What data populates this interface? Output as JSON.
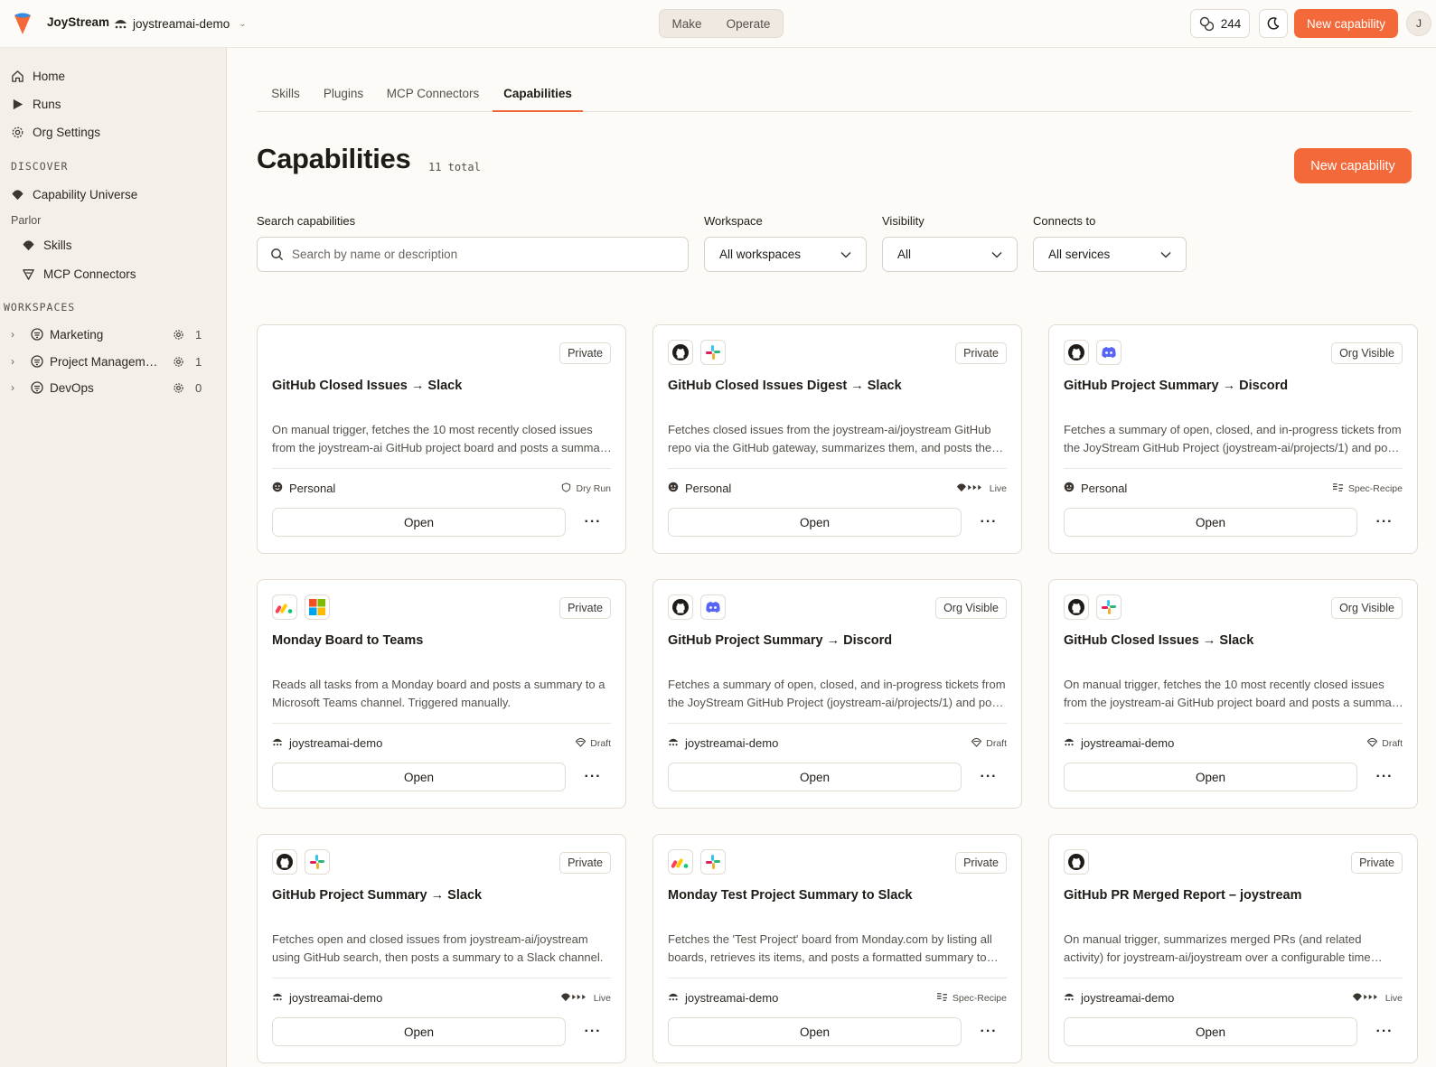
{
  "app": {
    "name": "JoyStream",
    "org": "joystreamai-demo"
  },
  "mode": {
    "make": "Make",
    "operate": "Operate"
  },
  "credits": "244",
  "top_new_label": "New capability",
  "avatar_initial": "J",
  "sidebar": {
    "nav": [
      {
        "label": "Home"
      },
      {
        "label": "Runs"
      },
      {
        "label": "Org Settings"
      }
    ],
    "discover_heading": "DISCOVER",
    "capability_universe": "Capability Universe",
    "parlor_heading": "Parlor",
    "parlor_items": [
      {
        "label": "Skills"
      },
      {
        "label": "MCP Connectors"
      }
    ],
    "workspaces_heading": "WORKSPACES",
    "workspaces": [
      {
        "label": "Marketing",
        "count": "1"
      },
      {
        "label": "Project Management",
        "count": "1"
      },
      {
        "label": "DevOps",
        "count": "0"
      }
    ]
  },
  "tabs": [
    {
      "label": "Skills"
    },
    {
      "label": "Plugins"
    },
    {
      "label": "MCP Connectors"
    },
    {
      "label": "Capabilities"
    }
  ],
  "page": {
    "title": "Capabilities",
    "total": "11 total",
    "new_label": "New capability"
  },
  "filters": {
    "search_label": "Search capabilities",
    "search_placeholder": "Search by name or description",
    "workspace_label": "Workspace",
    "workspace_value": "All workspaces",
    "visibility_label": "Visibility",
    "visibility_value": "All",
    "connects_label": "Connects to",
    "connects_value": "All services"
  },
  "cards": [
    {
      "services": [],
      "visibility": "Private",
      "title": "GitHub Closed Issues → Slack",
      "description": "On manual trigger, fetches the 10 most recently closed issues from the joystream-ai GitHub project board and posts a summary to Slack.",
      "owner": "Personal",
      "owner_icon": "personal-icon",
      "status": "Dry Run",
      "open_label": "Open"
    },
    {
      "services": [
        "github",
        "slack"
      ],
      "visibility": "Private",
      "title": "GitHub Closed Issues Digest → Slack",
      "description": "Fetches closed issues from the joystream-ai/joystream GitHub repo via the GitHub gateway, summarizes them, and posts the digest to Slack.",
      "owner": "Personal",
      "owner_icon": "personal-icon",
      "status": "Live",
      "open_label": "Open"
    },
    {
      "services": [
        "github",
        "discord"
      ],
      "visibility": "Org Visible",
      "title": "GitHub Project Summary → Discord",
      "description": "Fetches a summary of open, closed, and in-progress tickets from the JoyStream GitHub Project (joystream-ai/projects/1) and posts it to Discord.",
      "owner": "Personal",
      "owner_icon": "personal-icon",
      "status": "Spec-Recipe",
      "open_label": "Open"
    },
    {
      "services": [
        "monday",
        "teams"
      ],
      "visibility": "Private",
      "title": "Monday Board to Teams",
      "description": "Reads all tasks from a Monday board and posts a summary to a Microsoft Teams channel. Triggered manually.",
      "owner": "joystreamai-demo",
      "owner_icon": "org-icon",
      "status": "Draft",
      "open_label": "Open"
    },
    {
      "services": [
        "github",
        "discord"
      ],
      "visibility": "Org Visible",
      "title": "GitHub Project Summary → Discord",
      "description": "Fetches a summary of open, closed, and in-progress tickets from the JoyStream GitHub Project (joystream-ai/projects/1) and posts it to Discord.",
      "owner": "joystreamai-demo",
      "owner_icon": "org-icon",
      "status": "Draft",
      "open_label": "Open"
    },
    {
      "services": [
        "github",
        "slack"
      ],
      "visibility": "Org Visible",
      "title": "GitHub Closed Issues → Slack",
      "description": "On manual trigger, fetches the 10 most recently closed issues from the joystream-ai GitHub project board and posts a summary to Slack.",
      "owner": "joystreamai-demo",
      "owner_icon": "org-icon",
      "status": "Draft",
      "open_label": "Open"
    },
    {
      "services": [
        "github",
        "slack"
      ],
      "visibility": "Private",
      "title": "GitHub Project Summary → Slack",
      "description": "Fetches open and closed issues from joystream-ai/joystream using GitHub search, then posts a summary to a Slack channel.",
      "owner": "joystreamai-demo",
      "owner_icon": "org-icon",
      "status": "Live",
      "open_label": "Open"
    },
    {
      "services": [
        "monday",
        "slack"
      ],
      "visibility": "Private",
      "title": "Monday Test Project Summary to Slack",
      "description": "Fetches the 'Test Project' board from Monday.com by listing all boards, retrieves its items, and posts a formatted summary to Slack.",
      "owner": "joystreamai-demo",
      "owner_icon": "org-icon",
      "status": "Spec-Recipe",
      "open_label": "Open"
    },
    {
      "services": [
        "github"
      ],
      "visibility": "Private",
      "title": "GitHub PR Merged Report – joystream",
      "description": "On manual trigger, summarizes merged PRs (and related activity) for joystream-ai/joystream over a configurable time window.",
      "owner": "joystreamai-demo",
      "owner_icon": "org-icon",
      "status": "Live",
      "open_label": "Open"
    }
  ],
  "colors": {
    "accent": "#f4693a",
    "sidebar_bg": "#f4efe8",
    "page_bg": "#fdfbf8"
  }
}
